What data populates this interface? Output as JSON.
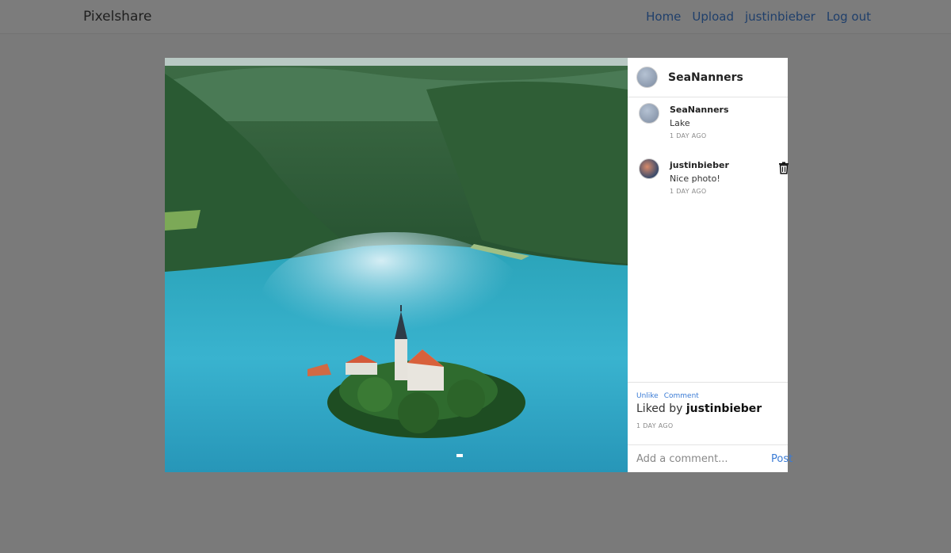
{
  "nav": {
    "brand": "Pixelshare",
    "links": [
      "Home",
      "Upload",
      "justinbieber",
      "Log out"
    ]
  },
  "post": {
    "owner": "SeaNanners",
    "photo_icon": "lake-island-photo",
    "comments": [
      {
        "user": "SeaNanners",
        "text": "Lake",
        "time": "1 DAY AGO",
        "deletable": false
      },
      {
        "user": "justinbieber",
        "text": "Nice photo!",
        "time": "1 DAY AGO",
        "deletable": true
      }
    ],
    "actions": {
      "unlike": "Unlike",
      "comment": "Comment"
    },
    "liked_by_prefix": "Liked by",
    "liked_by_user": "justinbieber",
    "time": "1 DAY AGO"
  },
  "form": {
    "placeholder": "Add a comment...",
    "post_label": "Post"
  }
}
